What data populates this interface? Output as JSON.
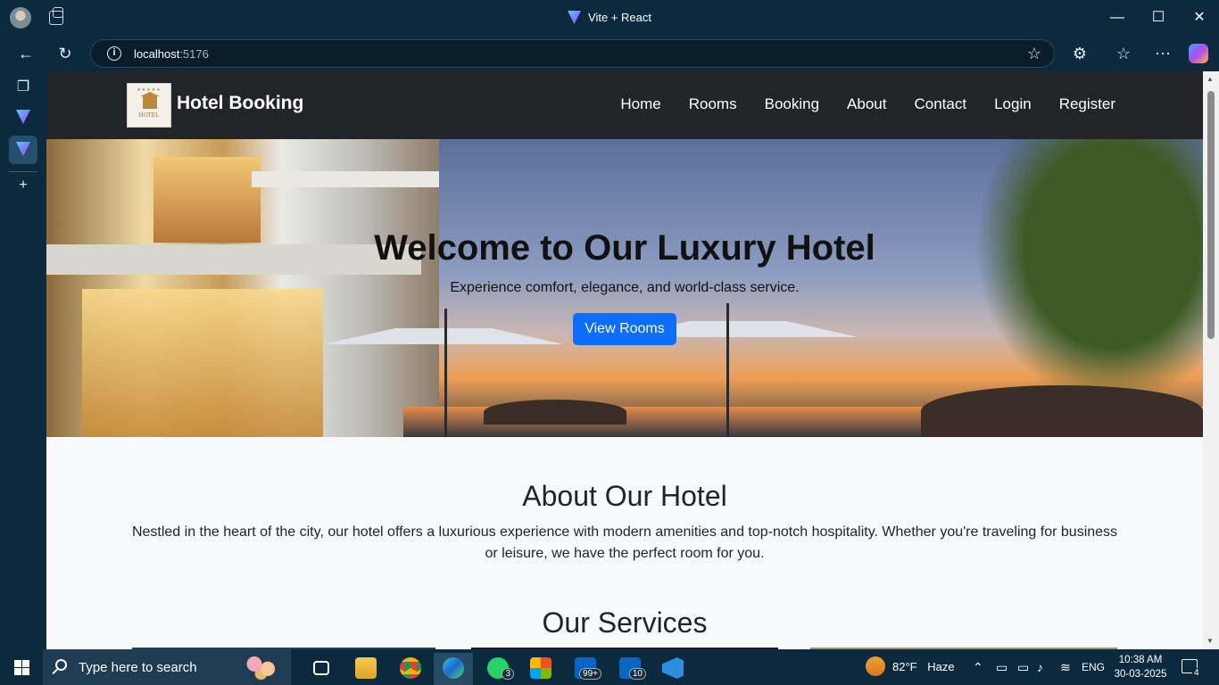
{
  "browser": {
    "tab_title": "Vite + React",
    "url_host": "localhost",
    "url_port": ":5176",
    "window_controls": {
      "minimize": "—",
      "maximize": "☐",
      "close": "✕"
    }
  },
  "site": {
    "brand": "Hotel Booking",
    "logo_text": "HOTEL",
    "logo_stars": "★★★★★",
    "nav": [
      "Home",
      "Rooms",
      "Booking",
      "About",
      "Contact",
      "Login",
      "Register"
    ],
    "hero": {
      "title": "Welcome to Our Luxury Hotel",
      "subtitle": "Experience comfort, elegance, and world-class service.",
      "cta": "View Rooms"
    },
    "about": {
      "title": "About Our Hotel",
      "text": "Nestled in the heart of the city, our hotel offers a luxurious experience with modern amenities and top-notch hospitality. Whether you're traveling for business or leisure, we have the perfect room for you."
    },
    "services_title": "Our Services"
  },
  "taskbar": {
    "search_placeholder": "Type here to search",
    "whatsapp_badge": "3",
    "outlook_badge": "99+",
    "linkedin_badge": "10",
    "weather_temp": "82°F",
    "weather_desc": "Haze",
    "language": "ENG",
    "time": "10:38 AM",
    "date": "30-03-2025",
    "notification_count": "4"
  },
  "colors": {
    "accent_button": "#0d6efd",
    "site_navbar": "#212529",
    "browser_frame": "#0c2a3e"
  }
}
